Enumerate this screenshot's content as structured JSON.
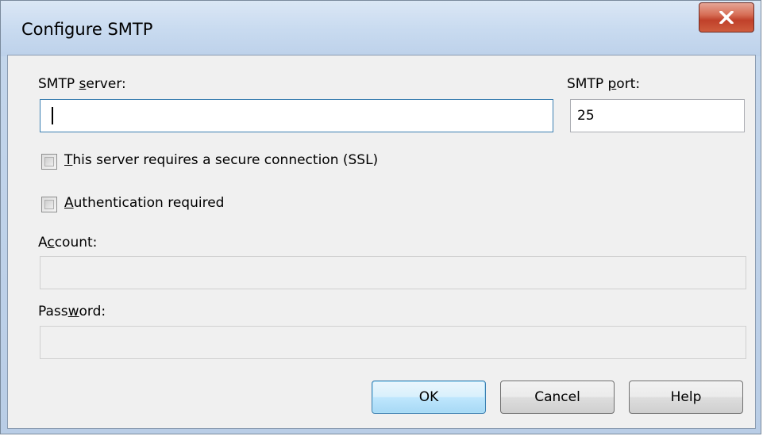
{
  "window": {
    "title": "Configure SMTP"
  },
  "form": {
    "smtp_server": {
      "label_pre": "SMTP ",
      "label_accel": "s",
      "label_post": "erver:",
      "value": ""
    },
    "smtp_port": {
      "label_pre": "SMTP ",
      "label_accel": "p",
      "label_post": "ort:",
      "value": "25"
    },
    "ssl": {
      "label_accel": "T",
      "label_post": "his server requires a secure connection (SSL)",
      "checked": false
    },
    "auth": {
      "label_accel": "A",
      "label_post": "uthentication required",
      "checked": false
    },
    "account": {
      "label_pre": "A",
      "label_accel": "c",
      "label_post": "count:",
      "value": "",
      "enabled": false
    },
    "password": {
      "label_pre": "Pass",
      "label_accel": "w",
      "label_post": "ord:",
      "value": "",
      "enabled": false
    }
  },
  "buttons": {
    "ok": "OK",
    "cancel": "Cancel",
    "help": "Help"
  },
  "colors": {
    "close_button": "#c7452c",
    "focus_border": "#3c7fb1",
    "client_background": "#f0f0f0"
  }
}
